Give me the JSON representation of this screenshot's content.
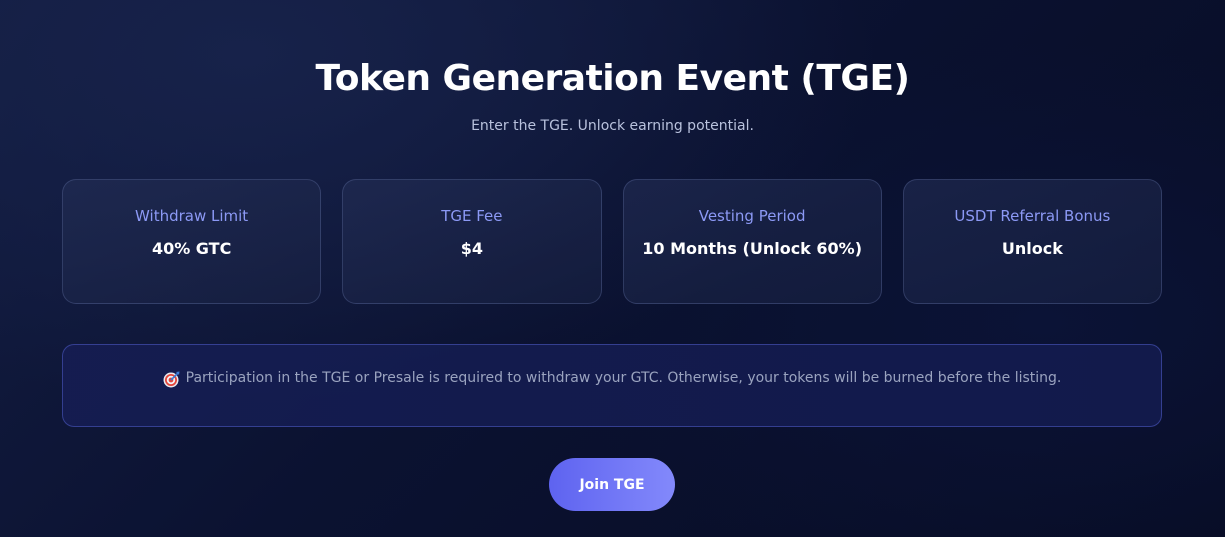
{
  "header": {
    "title": "Token Generation Event (TGE)",
    "subtitle": "Enter the TGE. Unlock earning potential."
  },
  "cards": [
    {
      "label": "Withdraw Limit",
      "value": "40% GTC"
    },
    {
      "label": "TGE Fee",
      "value": "$4"
    },
    {
      "label": "Vesting Period",
      "value": "10 Months (Unlock 60%)"
    },
    {
      "label": "USDT Referral Bonus",
      "value": "Unlock"
    }
  ],
  "notice": {
    "icon": "target-icon",
    "text": "Participation in the TGE or Presale is required to withdraw your GTC. Otherwise, your tokens will be burned before the listing."
  },
  "actions": {
    "join_label": "Join TGE"
  },
  "colors": {
    "accent": "#8c99f5",
    "button_start": "#5e63f0",
    "button_end": "#8389fb",
    "background": "#0b1231"
  }
}
